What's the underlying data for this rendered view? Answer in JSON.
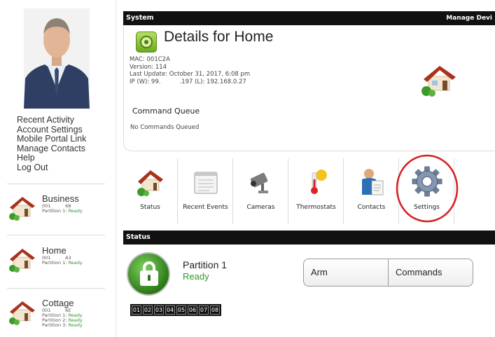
{
  "sidebar": {
    "nav": [
      "Recent Activity",
      "Account Settings",
      "Mobile Portal Link",
      "Manage Contacts",
      "Help",
      "Log Out"
    ],
    "locations": [
      {
        "name": "Business",
        "id": "001          68",
        "partitions": [
          {
            "label": "Partition 1:",
            "state": "Ready"
          }
        ]
      },
      {
        "name": "Home",
        "id": "001          A3",
        "partitions": [
          {
            "label": "Partition 1:",
            "state": "Ready"
          }
        ]
      },
      {
        "name": "Cottage",
        "id": "001          6E",
        "partitions": [
          {
            "label": "Partition 1:",
            "state": "Ready"
          },
          {
            "label": "Partition 2:",
            "state": "Ready"
          },
          {
            "label": "Partition 3:",
            "state": "Ready"
          }
        ]
      }
    ]
  },
  "system": {
    "bar_title": "System",
    "bar_right": "Manage Devi",
    "title": "Details for Home",
    "meta": "MAC: 001C2A\nVersion: 114\nLast Update: October 31, 2017, 6:08 pm\nIP (W): 99.          .197 (L): 192.168.0.27",
    "command_queue_title": "Command Queue",
    "command_queue_empty": "No Commands Queued"
  },
  "toolbar": [
    "Status",
    "Recent Events",
    "Cameras",
    "Thermostats",
    "Contacts",
    "Settings"
  ],
  "status": {
    "bar_title": "Status",
    "partition_name": "Partition 1",
    "partition_state": "Ready",
    "zones": [
      "01",
      "02",
      "03",
      "04",
      "05",
      "06",
      "07",
      "08"
    ],
    "arm_label": "Arm",
    "commands_label": "Commands"
  },
  "colors": {
    "ready": "#2e9a2e",
    "bar": "#111111",
    "highlight_ring": "#d42020"
  }
}
